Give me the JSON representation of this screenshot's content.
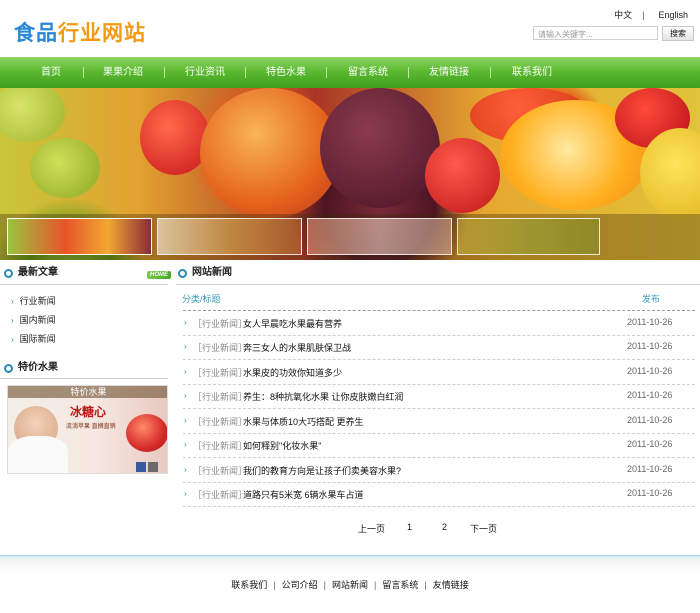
{
  "header": {
    "logo_part1": "食品",
    "logo_part2": "行业网站",
    "lang_cn": "中文",
    "lang_sep": "|",
    "lang_en": "English",
    "search_placeholder": "请输入关键字...",
    "search_button": "搜索"
  },
  "nav": {
    "items": [
      "首页",
      "果果介绍",
      "行业资讯",
      "特色水果",
      "留言系统",
      "友情链接",
      "联系我们"
    ]
  },
  "left": {
    "latest_title": "最新文章",
    "more": "HOME",
    "categories": [
      "行业新闻",
      "国内新闻",
      "国际新闻"
    ],
    "special_title": "特价水果",
    "promo_caption": "特价水果",
    "promo_text1": "冰糖心",
    "promo_text2": "流淌苹果 直摘直销"
  },
  "news": {
    "title": "网站新闻",
    "col_category": "分类/标题",
    "col_date": "发布",
    "rows": [
      {
        "cat": "［行业新闻］",
        "title": "女人早晨吃水果最有营养",
        "date": "2011-10-26"
      },
      {
        "cat": "［行业新闻］",
        "title": "奔三女人的水果肌肤保卫战",
        "date": "2011-10-26"
      },
      {
        "cat": "［行业新闻］",
        "title": "水果皮的功效你知道多少",
        "date": "2011-10-26"
      },
      {
        "cat": "［行业新闻］",
        "title": "养生：8种抗氧化水果 让你皮肤嫩白红润",
        "date": "2011-10-26"
      },
      {
        "cat": "［行业新闻］",
        "title": "水果与体质10大巧搭配 更养生",
        "date": "2011-10-26"
      },
      {
        "cat": "［行业新闻］",
        "title": "如何释别\"化妆水果\"",
        "date": "2011-10-26"
      },
      {
        "cat": "［行业新闻］",
        "title": "我们的教育方向是让孩子们卖美容水果?",
        "date": "2011-10-26"
      },
      {
        "cat": "［行业新闻］",
        "title": "道路只有5米宽 6辆水果车占道",
        "date": "2011-10-26"
      }
    ]
  },
  "pager": {
    "prev": "上一页",
    "page1": "1",
    "page2": "2",
    "next": "下一页"
  },
  "footer": {
    "links": [
      "联系我们",
      "公司介绍",
      "网站新闻",
      "留言系统",
      "友情链接"
    ],
    "sep": "|"
  },
  "colors": {
    "nav_green": "#5cba31",
    "accent_blue": "#2a8ab8",
    "logo_blue": "#2a86d6",
    "logo_orange": "#f39a12"
  }
}
